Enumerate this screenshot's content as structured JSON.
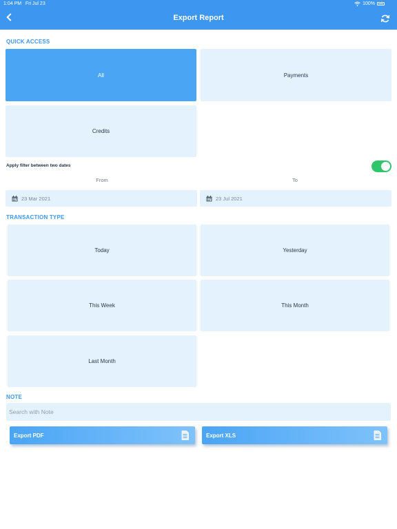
{
  "status": {
    "time": "1:04 PM",
    "date": "Fri Jul 23",
    "battery": "100%"
  },
  "header": {
    "title": "Export Report"
  },
  "quick_access": {
    "label": "QUICK ACCESS",
    "items": [
      {
        "label": "All",
        "selected": true
      },
      {
        "label": "Payments",
        "selected": false
      },
      {
        "label": "Credits",
        "selected": false
      }
    ]
  },
  "date_filter": {
    "label": "Apply filter between two dates",
    "enabled": true,
    "from_label": "From",
    "to_label": "To",
    "from_value": "23 Mar 2021",
    "to_value": "23 Jul 2021"
  },
  "transaction_type": {
    "label": "TRANSACTION TYPE",
    "items": [
      "Today",
      "Yesterday",
      "This Week",
      "This Month",
      "Last Month"
    ]
  },
  "note": {
    "label": "NOTE",
    "placeholder": "Search with Note",
    "value": ""
  },
  "export": {
    "pdf_label": "Export PDF",
    "xls_label": "Export XLS"
  },
  "colors": {
    "accent": "#3d97f0",
    "tile": "#e4f2fe",
    "tile_selected": "#4aa5f5",
    "toggle_on": "#2fc56a"
  }
}
